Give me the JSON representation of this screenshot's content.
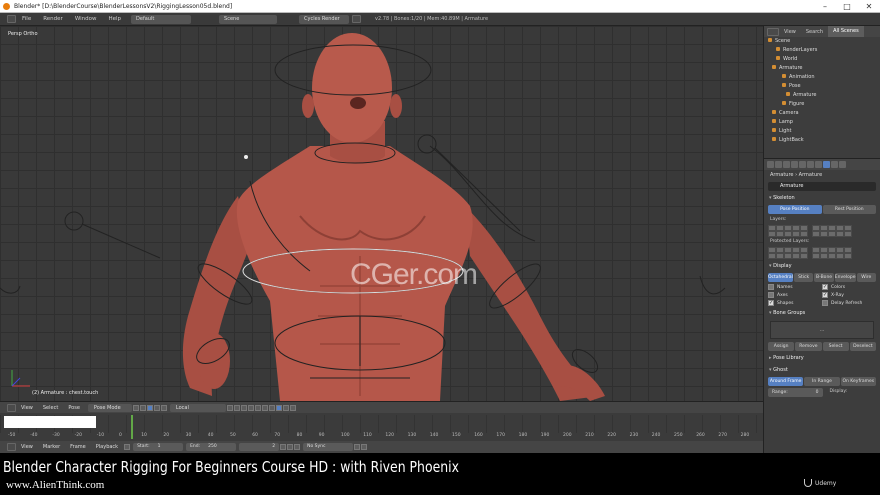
{
  "window": {
    "title": "Blender* [D:\\BlenderCourse\\BlenderLessonsV2\\RiggingLesson05d.blend]"
  },
  "infobar": {
    "menus": [
      "File",
      "Render",
      "Window",
      "Help"
    ],
    "layout": "Default",
    "scene": "Scene",
    "engine": "Cycles Render",
    "stats": "v2.78 | Bones:1/20 | Mem:40.89M | Armature"
  },
  "viewport": {
    "view_label": "Persp Ortho",
    "status": "(2) Armature : chest.touch",
    "watermark": "CGer.com",
    "header": {
      "menus": [
        "View",
        "Select",
        "Pose"
      ],
      "mode": "Pose Mode",
      "pivot": "Local"
    }
  },
  "timeline": {
    "ticks": [
      "-50",
      "-40",
      "-30",
      "-20",
      "-10",
      "0",
      "10",
      "20",
      "30",
      "40",
      "50",
      "60",
      "70",
      "80",
      "90",
      "100",
      "110",
      "120",
      "130",
      "140",
      "150",
      "160",
      "170",
      "180",
      "190",
      "200",
      "210",
      "220",
      "230",
      "240",
      "250",
      "260",
      "270",
      "280"
    ],
    "menus": [
      "View",
      "Marker",
      "Frame",
      "Playback"
    ],
    "start_label": "Start:",
    "start": "1",
    "end_label": "End:",
    "end": "250",
    "current": "2",
    "sync": "No Sync"
  },
  "outliner": {
    "tabs": [
      "View",
      "Search",
      "All Scenes"
    ],
    "rows": [
      "Scene",
      "RenderLayers",
      "World",
      "Armature",
      "Animation",
      "Pose",
      "Armature",
      "Figure",
      "Camera",
      "Lamp",
      "Light",
      "LightBack"
    ]
  },
  "properties": {
    "breadcrumb_a": "Armature",
    "breadcrumb_b": "Armature",
    "name": "Armature",
    "skeleton": {
      "title": "Skeleton",
      "pose_position": "Pose Position",
      "rest_position": "Rest Position",
      "layers": "Layers:",
      "protected_layers": "Protected Layers:"
    },
    "display": {
      "title": "Display",
      "modes": [
        "Octahedral",
        "Stick",
        "B-Bone",
        "Envelope",
        "Wire"
      ],
      "names": "Names",
      "colors": "Colors",
      "axes": "Axes",
      "xray": "X-Ray",
      "shapes": "Shapes",
      "delay_refresh": "Delay Refresh"
    },
    "bone_groups": {
      "title": "Bone Groups",
      "list_text": "...",
      "assign": "Assign",
      "remove": "Remove",
      "select": "Select",
      "deselect": "Deselect"
    },
    "pose_library": "Pose Library",
    "ghost": {
      "title": "Ghost",
      "around": "Around Frame",
      "in_range": "In Range",
      "on_keyframes": "On Keyframes",
      "range_label": "Range:",
      "range": "0",
      "display": "Display:"
    }
  },
  "caption": {
    "title": "Blender Character Rigging For Beginners Course HD : with Riven Phoenix",
    "site": "www.AlienThink.com",
    "brand": "Udemy"
  },
  "colors": {
    "model": "#b5574a",
    "accent": "#5680c2"
  }
}
